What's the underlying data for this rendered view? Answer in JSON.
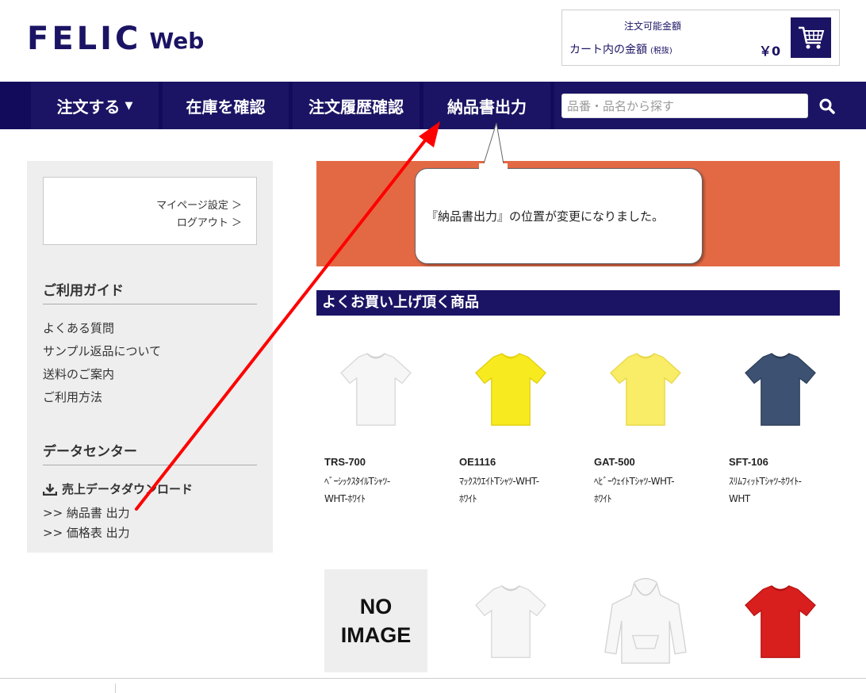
{
  "header": {
    "logo_main": "FELIC",
    "logo_sub": "Web",
    "cart": {
      "available_label": "注文可能金額",
      "in_cart_label": "カート内の金額",
      "tax_note": "(税抜)",
      "amount": "￥0",
      "icon": "shopping-cart-icon"
    }
  },
  "nav": {
    "items": [
      {
        "label": "注文する",
        "caret": "▼"
      },
      {
        "label": "在庫を確認"
      },
      {
        "label": "注文履歴確認"
      },
      {
        "label": "納品書出力"
      }
    ],
    "search": {
      "placeholder": "品番・品名から探す",
      "icon": "search-icon"
    }
  },
  "sidebar": {
    "mypage_links": [
      "マイページ設定 ＞",
      "ログアウト ＞"
    ],
    "guide": {
      "heading": "ご利用ガイド",
      "links": [
        "よくある質問",
        "サンプル返品について",
        "送料のご案内",
        "ご利用方法"
      ]
    },
    "data_center": {
      "heading": "データセンター",
      "download": "売上データダウンロード",
      "links": [
        ">> 納品書 出力",
        ">> 価格表 出力"
      ]
    }
  },
  "banner": {
    "color": "#e36944",
    "callout": "『納品書出力』の位置が変更になりました。"
  },
  "products_section": {
    "title": "よくお買い上げ頂く商品",
    "items": [
      {
        "code": "TRS-700",
        "name_line1": "ﾍﾞｰｼｯｸｽﾀｲﾙTｼｬﾂ-",
        "name_line2": "WHT-ﾎﾜｲﾄ",
        "image": "white-tshirt",
        "color": "#f6f6f6"
      },
      {
        "code": "OE1116",
        "name_line1": "ﾏｯｸｽｳｴｲﾄTｼｬﾂ-WHT-",
        "name_line2": "ﾎﾜｲﾄ",
        "image": "yellow-tshirt",
        "color": "#f7ea1e"
      },
      {
        "code": "GAT-500",
        "name_line1": "ﾍﾋﾞｰｳｪｲﾄTｼｬﾂ-WHT-",
        "name_line2": "ﾎﾜｲﾄ",
        "image": "light-yellow-tshirt",
        "color": "#f9ec66"
      },
      {
        "code": "SFT-106",
        "name_line1": "ｽﾘﾑﾌｨｯﾄTｼｬﾂ-ﾎﾜｲﾄ-",
        "name_line2": "WHT",
        "image": "navy-tshirt",
        "color": "#3d5273"
      }
    ],
    "row2": [
      {
        "image": "no-image",
        "text_line1": "NO",
        "text_line2": "IMAGE"
      },
      {
        "image": "white-tshirt",
        "color": "#f6f6f6"
      },
      {
        "image": "white-hoodie",
        "color": "#f7f7f7"
      },
      {
        "image": "red-tshirt",
        "color": "#d91e1e"
      }
    ]
  },
  "colors": {
    "navy": "#1b1464",
    "nav_bg": "#120b5c",
    "arrow": "#ff0000"
  }
}
